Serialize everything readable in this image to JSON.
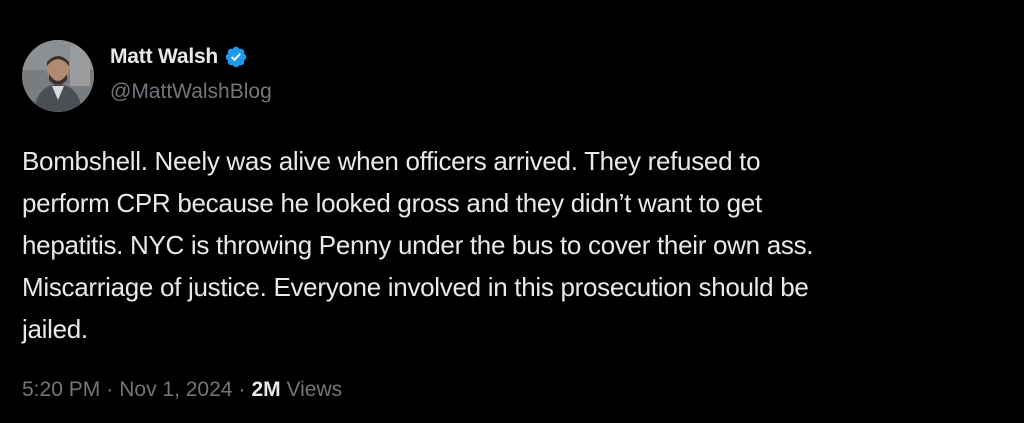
{
  "author": {
    "display_name": "Matt Walsh",
    "handle": "@MattWalshBlog",
    "verified_icon": "verified-badge-icon",
    "badge_color": "#1d9bf0"
  },
  "tweet": {
    "text": "Bombshell. Neely was alive when officers arrived. They refused to\nperform CPR because he looked gross and they didn’t want to get\nhepatitis. NYC is throwing Penny under the bus to cover their own ass.\nMiscarriage of justice. Everyone involved in this prosecution should be\njailed."
  },
  "meta": {
    "time": "5:20 PM",
    "separator": "·",
    "date": "Nov 1, 2024",
    "views_count": "2M",
    "views_label": "Views"
  },
  "colors": {
    "background": "#000000",
    "primary_text": "#e7e9ea",
    "secondary_text": "#71767b"
  }
}
